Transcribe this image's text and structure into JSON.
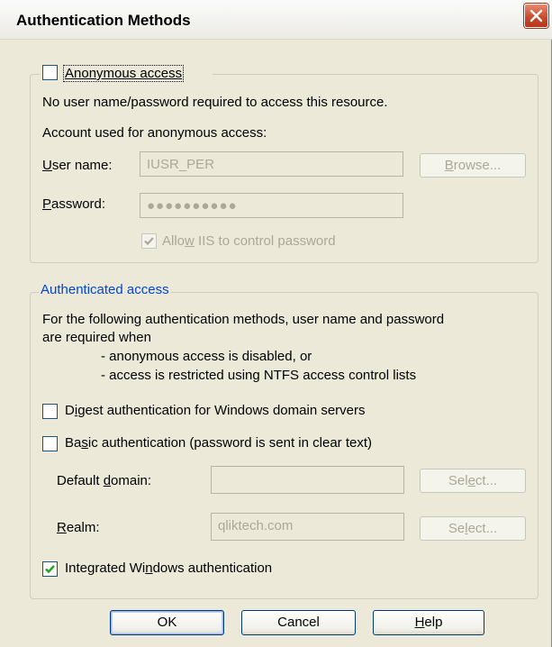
{
  "window": {
    "title": "Authentication Methods"
  },
  "anonymous": {
    "checkbox_label": "Anonymous access",
    "checked": false,
    "description": "No user name/password required to access this resource.",
    "account_label": "Account used for anonymous access:",
    "username_label": "User name:",
    "username_value": "IUSR_PER",
    "browse_button": "Browse...",
    "password_label": "Password:",
    "password_value": "●●●●●●●●●●",
    "allow_iis_label": "Allow IIS to control password",
    "allow_iis_checked": true
  },
  "authenticated": {
    "legend": "Authenticated access",
    "description_line1": "For the following authentication methods, user name and password",
    "description_line2": "are required when",
    "bullet1": "- anonymous access is disabled, or",
    "bullet2": "- access is restricted using NTFS access control lists",
    "digest_label": "Digest authentication for Windows domain servers",
    "digest_checked": false,
    "basic_label": "Basic authentication (password is sent in clear text)",
    "basic_checked": false,
    "default_domain_label": "Default domain:",
    "default_domain_value": "",
    "select_button_1": "Select...",
    "realm_label": "Realm:",
    "realm_value": "qliktech.com",
    "select_button_2": "Select...",
    "integrated_label": "Integrated Windows authentication",
    "integrated_checked": true
  },
  "buttons": {
    "ok": "OK",
    "cancel": "Cancel",
    "help": "Help"
  },
  "colors": {
    "legend_blue": "#0046d5",
    "dialog_bg": "#ece9d8",
    "disabled_text": "#aca899"
  }
}
